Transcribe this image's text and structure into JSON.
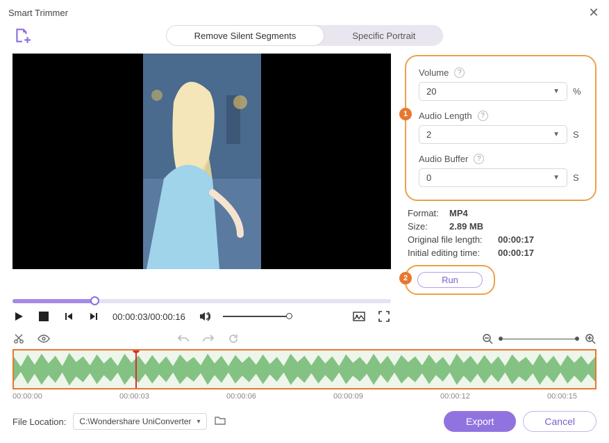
{
  "window": {
    "title": "Smart Trimmer"
  },
  "tabs": {
    "remove_silent": "Remove Silent Segments",
    "specific_portrait": "Specific Portrait"
  },
  "params": {
    "volume_label": "Volume",
    "volume_value": "20",
    "volume_unit": "%",
    "audio_length_label": "Audio Length",
    "audio_length_value": "2",
    "audio_length_unit": "S",
    "audio_buffer_label": "Audio Buffer",
    "audio_buffer_value": "0",
    "audio_buffer_unit": "S"
  },
  "badges": {
    "one": "1",
    "two": "2"
  },
  "meta": {
    "format_k": "Format:",
    "format_v": "MP4",
    "size_k": "Size:",
    "size_v": "2.89 MB",
    "orig_k": "Original file length:",
    "orig_v": "00:00:17",
    "init_k": "Initial editing time:",
    "init_v": "00:00:17"
  },
  "run": {
    "label": "Run"
  },
  "player": {
    "time": "00:00:03/00:00:16"
  },
  "ruler": {
    "t0": "00:00:00",
    "t1": "00:00:03",
    "t2": "00:00:06",
    "t3": "00:00:09",
    "t4": "00:00:12",
    "t5": "00:00:15"
  },
  "bottom": {
    "location_label": "File Location:",
    "location_value": "C:\\Wondershare UniConverter",
    "export": "Export",
    "cancel": "Cancel"
  }
}
